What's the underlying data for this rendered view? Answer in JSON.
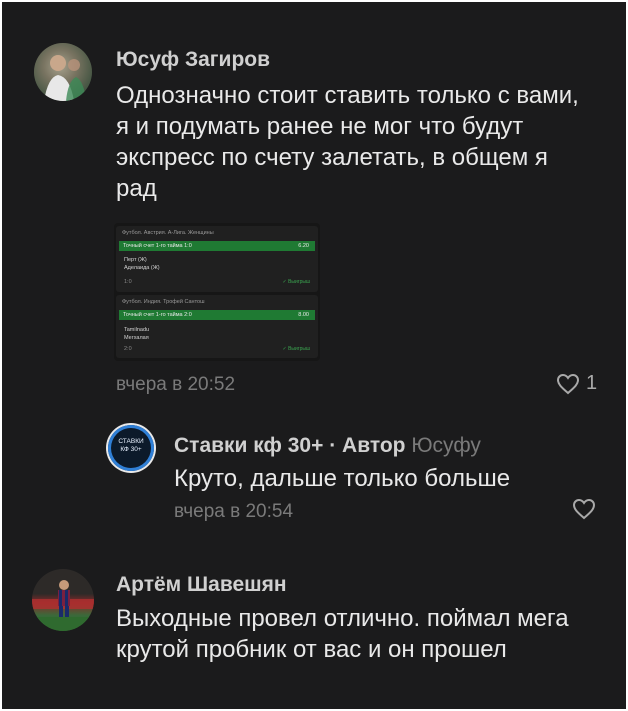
{
  "comments": [
    {
      "author": "Юсуф Загиров",
      "text": "Однозначно стоит ставить только с вами, я и подумать ранее не мог что будут экспресс по счету залетать, в общем я рад",
      "time": "вчера в 20:52",
      "likes": "1",
      "attachment": {
        "bets": [
          {
            "league": "Футбол. Австрия. А-Лига. Женщины",
            "market": "Точный счет 1-го тайма 1:0",
            "odds": "6.20",
            "team1": "Перт (Ж)",
            "team2": "Аделаида (Ж)",
            "score": "1:0",
            "status": "✓ Выигрыш"
          },
          {
            "league": "Футбол. Индия. Трофей Сантош",
            "market": "Точный счет 1-го тайма 2:0",
            "odds": "8.00",
            "team1": "Tamilnadu",
            "team2": "Мегхалая",
            "score": "2:0",
            "status": "✓ Выигрыш"
          }
        ]
      }
    },
    {
      "author": "Ставки кф 30+",
      "author_badge": "· Автор",
      "reply_to": "Юсуфу",
      "avatar_text": "СТАВКИ\nКФ 30+",
      "text": "Круто, дальше только больше",
      "time": "вчера в 20:54"
    },
    {
      "author": "Артём Шавешян",
      "text": "Выходные провел отлично. поймал мега крутой пробник от вас и он прошел"
    }
  ],
  "icons": {
    "like": "heart-outline-icon"
  },
  "colors": {
    "background": "#1b1b1c",
    "accent_green": "#1f7a33",
    "author_avatar_ring": "#2f7fd6"
  }
}
